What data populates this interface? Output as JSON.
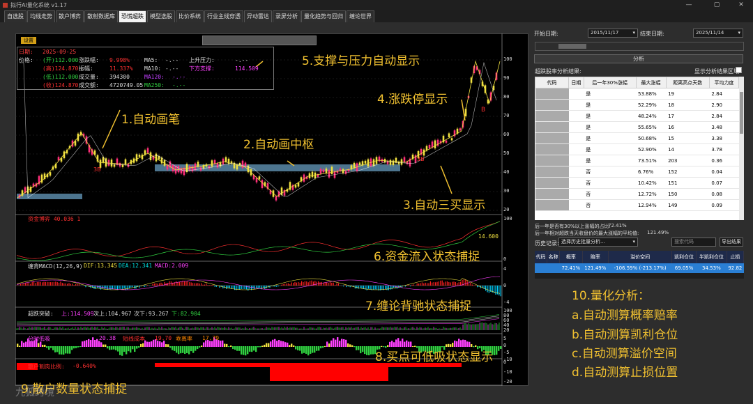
{
  "window": {
    "title": "拟行AI量化系统 v1.17",
    "controls": [
      "—",
      "▢",
      "✕"
    ]
  },
  "tabs": [
    "自选股",
    "均线走势",
    "散户博弈",
    "散射数据库",
    "恐慌超跌",
    "模型选股",
    "比价系统",
    "行业主线穿透",
    "异动雷达",
    "录屏分析",
    "量化趋势与回归",
    "缠论世界"
  ],
  "active_tab": 4,
  "chart": {
    "settings_label": "设置",
    "info": {
      "date_label": "日期:",
      "date": "2025-09-25",
      "price_label": "价格:",
      "open": "(开)112.000",
      "high": "(高)124.870",
      "low": "(低)112.000",
      "close": "(收)124.870",
      "chg_label": "涨跌幅:",
      "chg": "9.998%",
      "amp_label": "振幅:",
      "amp": "11.337%",
      "vol_label": "成交量:",
      "vol": "394300",
      "amt_label": "成交额:",
      "amt": "4720749.05",
      "ma5_label": "MA5:",
      "ma5": "-.--",
      "ma10_label": "MA10:",
      "ma10": "-.--",
      "ma120_label": "MA120:",
      "ma120": "-.--",
      "ma250_label": "MA250:",
      "ma250": "-.--",
      "res_label": "上升压力:",
      "res": "-.--",
      "sup_label": "下方支撑:",
      "sup": "114.509"
    },
    "yaxis_main": [
      "100",
      "90",
      "80",
      "70",
      "60",
      "50",
      "40",
      "30",
      "20"
    ],
    "yaxis_fund": [
      "100",
      "0"
    ],
    "yaxis_macd": [
      "4",
      "0",
      "-4"
    ],
    "yaxis_break": [
      "100",
      "80",
      "60",
      "40",
      "20"
    ],
    "yaxis_low": [
      "5",
      "0",
      "-5",
      "-10"
    ],
    "yaxis_retail": [
      "0",
      "-10",
      "-20"
    ],
    "markers": {
      "buy3": "3B",
      "buy": "B"
    },
    "fund": {
      "label": "资金博弈 40.036 1",
      "value": "14.600"
    },
    "macd": {
      "title": "缠背MACD(12,26,9)",
      "dif": "DIF:13.345",
      "dea": "DEA:12.341",
      "macd": "MACD:2.009"
    },
    "breakout": {
      "title": "超跌突破:",
      "up": "上:114.509",
      "up2": "次上:104.967",
      "down2": "次下:93.267",
      "down": "下:82.904"
    },
    "lowbuy": {
      "t1": "分时低吸",
      "t2": "20.38",
      "t3": "短线成本",
      "t4": "19.70",
      "t5": "乖离率",
      "t6": "17.79"
    },
    "retail": {
      "title": "散户割肉比例:",
      "value": "-0.640%"
    },
    "watermark": "九狐跨境",
    "annotations": [
      "1.自动画笔",
      "2.自动画中枢",
      "3.自动三买显示",
      "4.涨跌停显示",
      "5.支撑与压力自动显示",
      "6.资金流入状态捕捉",
      "7.缠论背驰状态捕捉",
      "8.买点可低吸状态显示",
      "9.散户数量状态捕捉"
    ]
  },
  "right": {
    "start_label": "开始日期:",
    "start": "2015/11/17",
    "end_label": "结束日期:",
    "end": "2025/11/14",
    "analyze": "分析",
    "result_label": "超跌股率分析结果:",
    "show_area": "显示分析结果区域",
    "columns": [
      "代码",
      "日期",
      "后一年30%涨幅",
      "最大涨幅",
      "距离高点天数",
      "平均力度"
    ],
    "rows": [
      {
        "flag": "是",
        "max": "53.88%",
        "days": "19",
        "avg": "2.84"
      },
      {
        "flag": "是",
        "max": "52.29%",
        "days": "18",
        "avg": "2.90"
      },
      {
        "flag": "是",
        "max": "48.24%",
        "days": "17",
        "avg": "2.84"
      },
      {
        "flag": "是",
        "max": "55.65%",
        "days": "16",
        "avg": "3.48"
      },
      {
        "flag": "是",
        "max": "50.68%",
        "days": "15",
        "avg": "3.38"
      },
      {
        "flag": "是",
        "max": "52.90%",
        "days": "14",
        "avg": "3.78"
      },
      {
        "flag": "是",
        "max": "73.51%",
        "days": "203",
        "avg": "0.36"
      },
      {
        "flag": "否",
        "max": "6.76%",
        "days": "152",
        "avg": "0.04"
      },
      {
        "flag": "否",
        "max": "10.42%",
        "days": "151",
        "avg": "0.07"
      },
      {
        "flag": "否",
        "max": "12.72%",
        "days": "150",
        "avg": "0.08"
      },
      {
        "flag": "否",
        "max": "12.94%",
        "days": "149",
        "avg": "0.09"
      }
    ],
    "summary1": "后一年是否有30%以上涨幅的占比:",
    "summary1_val": "72.41%",
    "summary2": "后一年相对超跌当天收盘价的最大涨幅的平均值:",
    "summary2_val": "121.49%",
    "hist_label": "历史记录:",
    "hist_select": "选择历史批量分析...",
    "search_placeholder": "搜索代码",
    "export": "导出结果",
    "hist_cols": [
      "代码",
      "名称",
      "概率",
      "赔率",
      "溢价空间",
      "凯利仓位",
      "半凯利仓位",
      "止损"
    ],
    "hist_row": [
      "",
      "",
      "72.41%",
      "121.49%",
      "-106.59% (-213.17%)",
      "69.05%",
      "34.53%",
      "92.82"
    ],
    "quant": [
      "10.量化分析：",
      "a.自动测算概率赔率",
      "b.自动测算凯利仓位",
      "c.自动测算溢价空间",
      "d.自动测算止损位置"
    ]
  },
  "colors": {
    "accent": "#f0c030",
    "up": "#ff3030",
    "down": "#30d040",
    "zone": "#5a8aa8",
    "header_blue": "#2a7fd4"
  }
}
